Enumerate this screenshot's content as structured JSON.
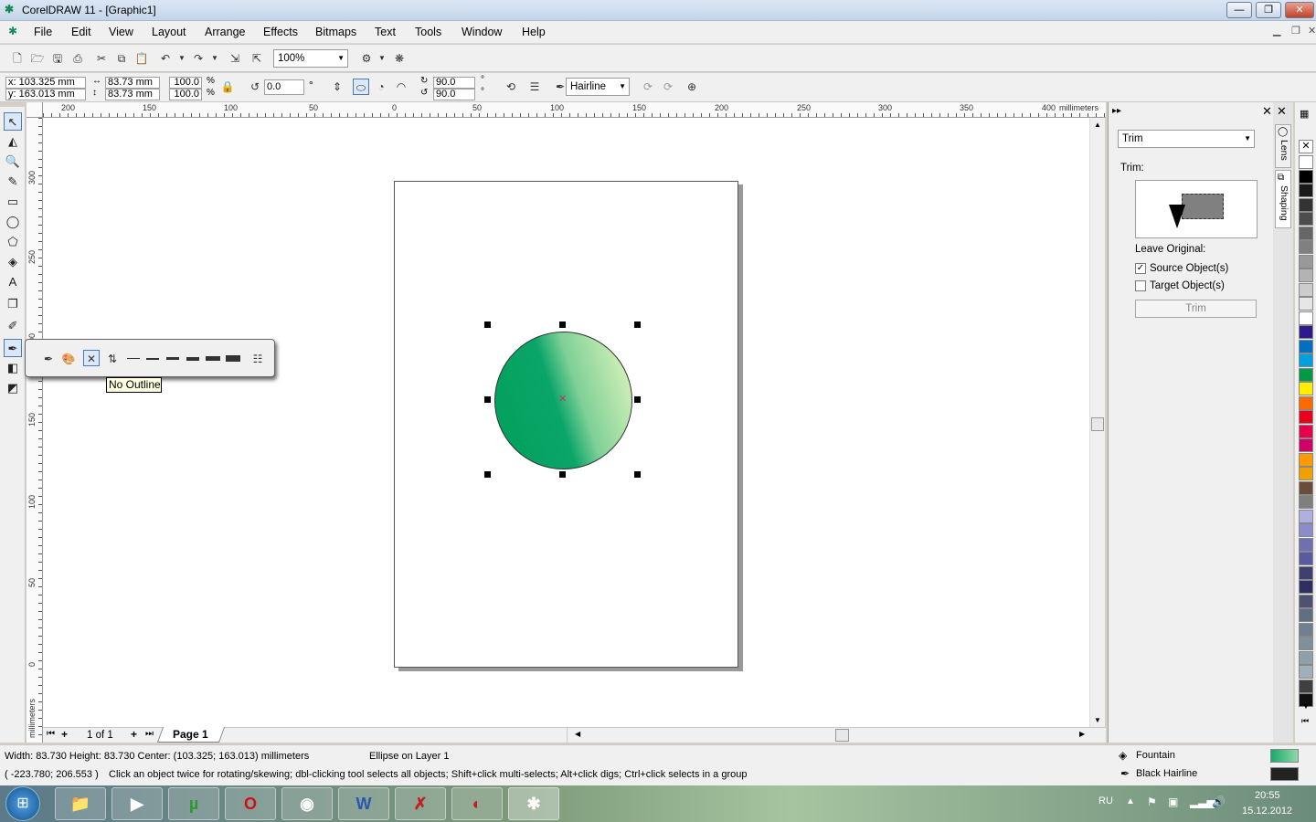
{
  "app": {
    "title": "CorelDRAW 11 - [Graphic1]"
  },
  "window_buttons": {
    "minimize": "—",
    "maximize": "❐",
    "close": "✕"
  },
  "menu": [
    "File",
    "Edit",
    "View",
    "Layout",
    "Arrange",
    "Effects",
    "Bitmaps",
    "Text",
    "Tools",
    "Window",
    "Help"
  ],
  "toolbar": {
    "zoom": "100%"
  },
  "propbar": {
    "x": "x: 103.325 mm",
    "y": "y: 163.013 mm",
    "width": "83.73 mm",
    "height": "83.73 mm",
    "scale_x": "100.0",
    "scale_y": "100.0",
    "percent": "%",
    "rotation": "0.0",
    "degree": "°",
    "start_angle": "90.0",
    "end_angle": "90.0",
    "outline": "Hairline"
  },
  "ruler": {
    "unit": "millimeters",
    "h_ticks": [
      "200",
      "150",
      "100",
      "50",
      "0",
      "50",
      "100",
      "150",
      "200",
      "250",
      "300",
      "350",
      "400"
    ],
    "v_ticks": [
      "300",
      "250",
      "200",
      "150",
      "100",
      "50",
      "0"
    ]
  },
  "flyout": {
    "tooltip": "No Outline"
  },
  "pagebar": {
    "counter": "1 of 1",
    "tab": "Page 1"
  },
  "docker": {
    "dropdown": "Trim",
    "section_label": "Trim:",
    "leave_original": "Leave Original:",
    "source_label": "Source Object(s)",
    "source_checked": true,
    "target_label": "Target Object(s)",
    "target_checked": false,
    "apply_button": "Trim",
    "tabs": [
      "Lens",
      "Shaping"
    ]
  },
  "palette_colors": [
    "#ffffff",
    "#000000",
    "#1a1a1a",
    "#333333",
    "#4d4d4d",
    "#666666",
    "#808080",
    "#999999",
    "#b3b3b3",
    "#cccccc",
    "#e6e6e6",
    "#ffffff",
    "#2e1a8c",
    "#0070c0",
    "#00a0e0",
    "#009a44",
    "#ffee00",
    "#ff6a00",
    "#e8001c",
    "#e6004c",
    "#cc0066",
    "#ff9900",
    "#f0a000",
    "#6b4c3b",
    "#7f7f7f",
    "#b0b0e0",
    "#8c8cc8",
    "#7070b0",
    "#5a5aa0",
    "#404070",
    "#303060",
    "#505070",
    "#607080",
    "#708090",
    "#809098",
    "#90a0a8",
    "#a0b0b8",
    "#404040",
    "#101010"
  ],
  "status": {
    "dims": "Width: 83.730  Height: 83.730  Center: (103.325; 163.013)  millimeters",
    "object": "Ellipse on Layer 1",
    "coords": "( -223.780; 206.553 )",
    "hint": "Click an object twice for rotating/skewing; dbl-clicking tool selects all objects; Shift+click multi-selects; Alt+click digs; Ctrl+click selects in a group",
    "fill_label": "Fountain",
    "outline_label": "Black  Hairline",
    "fill_color": "#1aa86a",
    "outline_color": "#222222"
  },
  "tray": {
    "lang": "RU",
    "time": "20:55",
    "date": "15.12.2012"
  }
}
